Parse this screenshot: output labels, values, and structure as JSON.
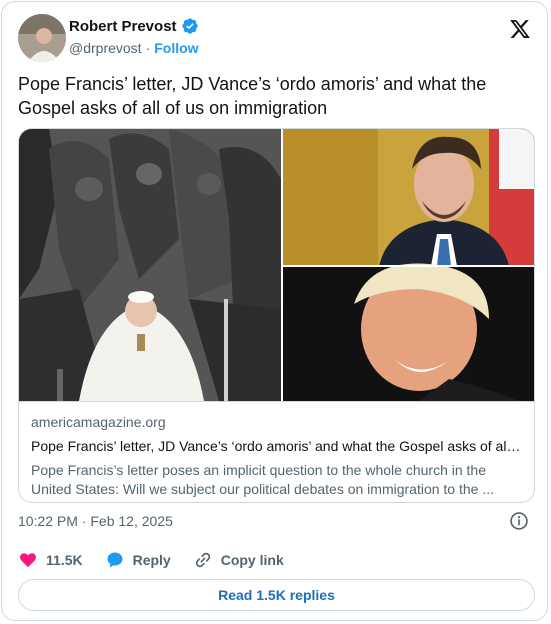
{
  "author": {
    "name": "Robert Prevost",
    "handle": "@drprevost",
    "separator": "·",
    "follow_label": "Follow"
  },
  "tweet": {
    "text": "Pope Francis’ letter, JD Vance’s ‘ordo amoris’ and what the Gospel asks of all of us on immigration"
  },
  "link_card": {
    "domain": "americamagazine.org",
    "title": "Pope Francis’ letter, JD Vance’s ‘ordo amoris’ and what the Gospel asks of all o...",
    "description": "Pope Francis’s letter poses an implicit question to the whole church in the United States: Will we subject our political debates on immigration to the ..."
  },
  "meta": {
    "timestamp": "10:22 PM · Feb 12, 2025"
  },
  "actions": {
    "likes": "11.5K",
    "reply_label": "Reply",
    "copy_label": "Copy link"
  },
  "replies_button": "Read 1.5K replies",
  "icons": [
    "verified-badge-icon",
    "x-logo-icon",
    "info-icon",
    "heart-icon",
    "reply-bubble-icon",
    "link-icon"
  ],
  "colors": {
    "accent": "#1d9bf0",
    "like": "#f91880",
    "text": "#0f1419",
    "muted": "#536471",
    "border": "#cfd9de"
  }
}
